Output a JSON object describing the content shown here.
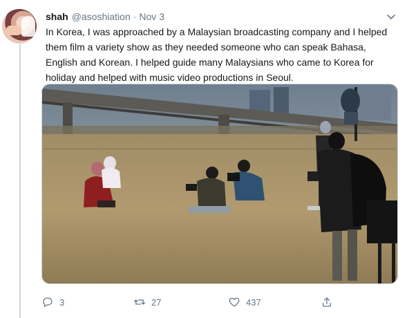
{
  "tweet": {
    "author_name": "shah",
    "author_handle": "@asoshiation",
    "separator": "·",
    "date": "Nov 3",
    "text": "In Korea, I was approached by a Malaysian broadcasting company and I helped them film a variety show as they needed someone who can speak Bahasa, English and Korean. I helped guide many Malaysians who came to Korea for holiday and helped with music video productions in Seoul."
  },
  "actions": {
    "reply_count": "3",
    "retweet_count": "27",
    "like_count": "437"
  },
  "icons": {
    "more": "chevron-down-icon",
    "reply": "reply-icon",
    "retweet": "retweet-icon",
    "like": "heart-icon",
    "share": "share-icon"
  },
  "colors": {
    "text": "#14171a",
    "secondary": "#657786",
    "border": "#ccd6dd"
  }
}
